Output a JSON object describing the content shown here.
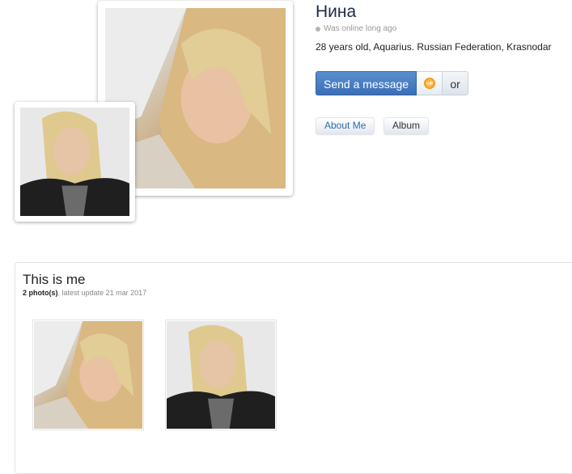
{
  "profile": {
    "name": "Нина",
    "status": "Was online long ago",
    "info": "28 years old, Aquarius. Russian Federation, Krasnodar"
  },
  "actions": {
    "send_message": "Send a message",
    "vip_icon": "vip-badge-icon",
    "or_label": "or"
  },
  "tabs": [
    {
      "label": "About Me"
    },
    {
      "label": "Album"
    }
  ],
  "album": {
    "title": "This is me",
    "photo_count": "2 photo(s)",
    "separator": ",",
    "latest_update": "latest update 21 mar 2017",
    "photos": [
      {
        "name": "album-photo-1"
      },
      {
        "name": "album-photo-2"
      }
    ]
  },
  "colors": {
    "accent": "#3b6fb6",
    "name_color": "#1d2b44",
    "link_color": "#2a6fb3"
  }
}
